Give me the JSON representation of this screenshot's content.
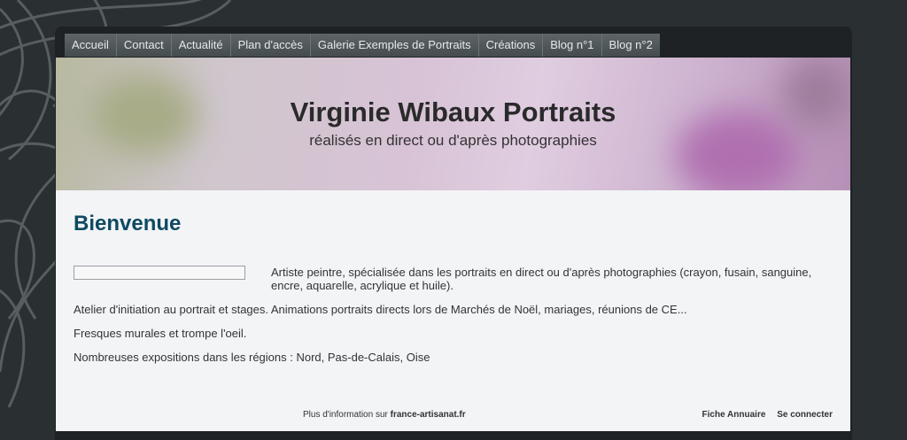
{
  "nav": {
    "items": [
      "Accueil",
      "Contact",
      "Actualité",
      "Plan d'accès",
      "Galerie Exemples de Portraits",
      "Créations",
      "Blog n°1",
      "Blog n°2"
    ]
  },
  "header": {
    "title": "Virginie Wibaux Portraits",
    "subtitle": "réalisés en direct ou d'après photographies"
  },
  "main": {
    "heading": "Bienvenue",
    "paragraphs": [
      "Artiste peintre, spécialisée dans les portraits en direct ou d'après photographies (crayon, fusain, sanguine, encre, aquarelle, acrylique et huile).",
      "Atelier d'initiation au portrait et stages. Animations portraits directs lors de Marchés de Noël, mariages, réunions de CE...",
      "Fresques murales et trompe l'oeil.",
      "Nombreuses expositions dans les régions : Nord, Pas-de-Calais, Oise"
    ]
  },
  "footer": {
    "info_prefix": "Plus d'information sur",
    "info_link": "france-artisanat.fr",
    "link_annuaire": "Fiche Annuaire",
    "link_login": "Se connecter"
  }
}
